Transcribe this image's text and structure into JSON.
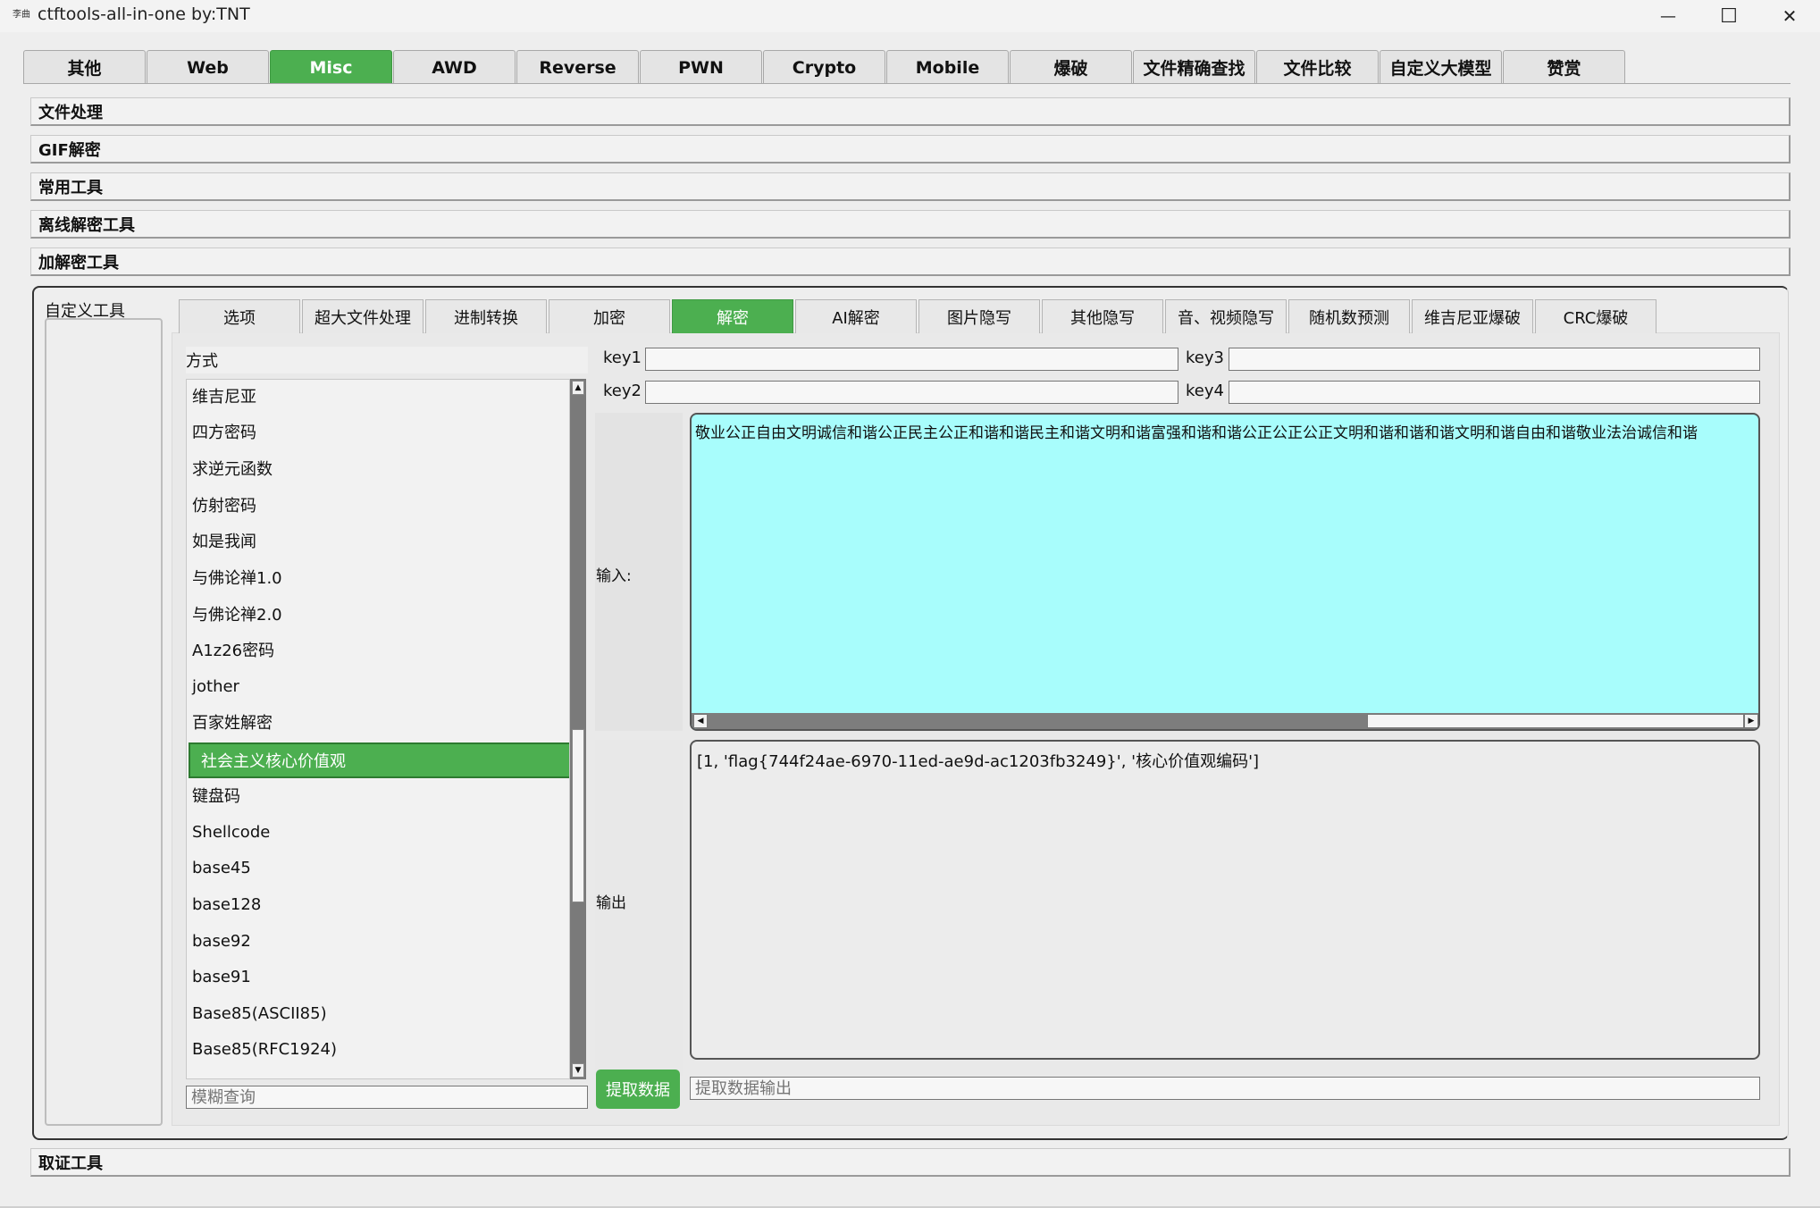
{
  "window": {
    "title": "ctftools-all-in-one   by:TNT",
    "app_icon_text": "李曲",
    "minimize_glyph": "—",
    "maximize_glyph": "☐",
    "close_glyph": "✕"
  },
  "top_tabs": [
    "其他",
    "Web",
    "Misc",
    "AWD",
    "Reverse",
    "PWN",
    "Crypto",
    "Mobile",
    "爆破",
    "文件精确查找",
    "文件比较",
    "自定义大模型",
    "赞赏"
  ],
  "top_tabs_active": "Misc",
  "sections": [
    "文件处理",
    "GIF解密",
    "常用工具",
    "离线解密工具",
    "加解密工具"
  ],
  "bottom_section": "取证工具",
  "custom_tools_label": "自定义工具",
  "sub_tabs": [
    "选项",
    "超大文件处理",
    "进制转换",
    "加密",
    "解密",
    "AI解密",
    "图片隐写",
    "其他隐写",
    "音、视频隐写",
    "随机数预测",
    "维吉尼亚爆破",
    "CRC爆破"
  ],
  "sub_tabs_active": "解密",
  "method_label": "方式",
  "methods": [
    "维吉尼亚",
    "四方密码",
    "求逆元函数",
    "仿射密码",
    "如是我闻",
    "与佛论禅1.0",
    "与佛论禅2.0",
    "A1z26密码",
    "jother",
    "百家姓解密",
    "社会主义核心价值观",
    "键盘码",
    "Shellcode",
    "base45",
    "base128",
    "base92",
    "base91",
    "Base85(ASCII85)",
    "Base85(RFC1924)"
  ],
  "methods_selected": "社会主义核心价值观",
  "fuzzy_placeholder": "模糊查询",
  "keys": {
    "key1_label": "key1",
    "key1_value": "",
    "key2_label": "key2",
    "key2_value": "",
    "key3_label": "key3",
    "key3_value": "",
    "key4_label": "key4",
    "key4_value": ""
  },
  "input_label": "输入:",
  "output_label": "输出",
  "input_text": "敬业公正自由文明诚信和谐公正民主公正和谐和谐民主和谐文明和谐富强和谐和谐公正公正公正文明和谐和谐和谐文明和谐自由和谐敬业法治诚信和谐",
  "output_text": "[1, 'flag{744f24ae-6970-11ed-ae9d-ac1203fb3249}', '核心价值观编码']",
  "extract_button": "提取数据",
  "extract_output_placeholder": "提取数据输出",
  "colors": {
    "accent": "#4caf50",
    "input_bg": "#a8fdfc",
    "window_bg": "#eeeeee"
  }
}
